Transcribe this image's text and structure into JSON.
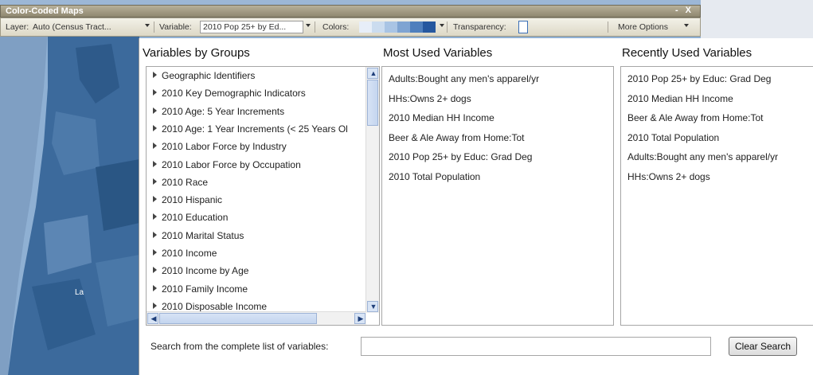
{
  "window": {
    "title": "Color-Coded Maps",
    "controls": "- X"
  },
  "toolbar": {
    "layer_label": "Layer:",
    "layer_value": "Auto (Census Tract...",
    "variable_label": "Variable:",
    "variable_value": "2010 Pop 25+ by Ed...",
    "colors_label": "Colors:",
    "color_ramp": [
      "#e7eef8",
      "#cbdcef",
      "#a9c4e4",
      "#7fa4d2",
      "#4f7fbd",
      "#26589f"
    ],
    "transparency_label": "Transparency:",
    "more_options_label": "More Options"
  },
  "groups": {
    "title": "Variables by Groups",
    "items": [
      "Geographic Identifiers",
      "2010 Key Demographic Indicators",
      "2010 Age: 5 Year Increments",
      "2010 Age: 1 Year Increments (< 25 Years Ol",
      "2010 Labor Force by Industry",
      "2010 Labor Force by Occupation",
      "2010 Race",
      "2010 Hispanic",
      "2010 Education",
      "2010 Marital Status",
      "2010 Income",
      "2010 Income by Age",
      "2010 Family Income",
      "2010 Disposable Income"
    ]
  },
  "most_used": {
    "title": "Most Used Variables",
    "items": [
      "Adults:Bought any men's apparel/yr",
      "HHs:Owns 2+ dogs",
      "2010 Median HH Income",
      "Beer & Ale Away from Home:Tot",
      "2010 Pop 25+ by Educ: Grad Deg",
      "2010 Total Population"
    ]
  },
  "recent": {
    "title": "Recently Used Variables",
    "items": [
      "2010 Pop 25+ by Educ: Grad Deg",
      "2010 Median HH Income",
      "Beer & Ale Away from Home:Tot",
      "2010 Total Population",
      "Adults:Bought any men's apparel/yr",
      "HHs:Owns 2+ dogs"
    ]
  },
  "search": {
    "label": "Search from the complete list of variables:",
    "value": "",
    "clear_label": "Clear Search"
  },
  "map": {
    "label": "La"
  }
}
